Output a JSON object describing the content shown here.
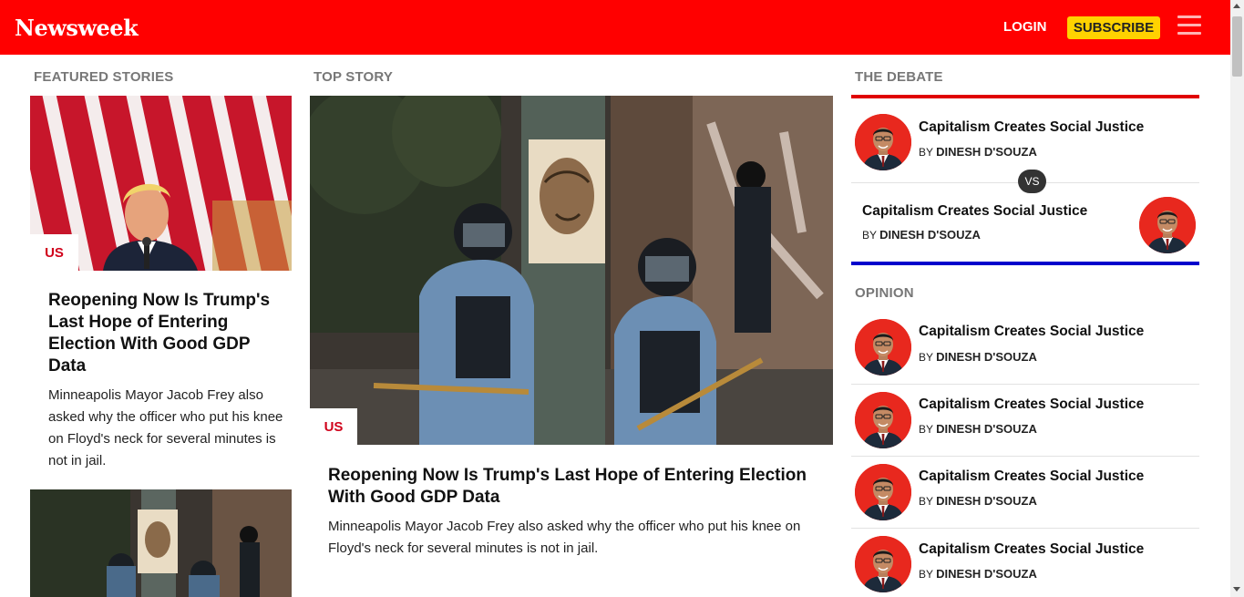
{
  "header": {
    "logo": "Newsweek",
    "login_label": "LOGIN",
    "subscribe_label": "SUBSCRIBE",
    "menu_icon": "hamburger-menu-icon",
    "brand_color": "#ff0000",
    "subscribe_color": "#ffd200"
  },
  "featured": {
    "label": "FEATURED STORIES",
    "items": [
      {
        "tag": "US",
        "headline": "Reopening Now Is Trump's Last Hope of Entering Election With Good GDP Data",
        "dek": "Minneapolis Mayor Jacob Frey also asked why the officer who put his knee on Floyd's neck for several minutes is not in jail."
      }
    ]
  },
  "top_story": {
    "label": "TOP STORY",
    "tag": "US",
    "headline": "Reopening Now Is Trump's Last Hope of Entering Election With Good GDP Data",
    "dek": "Minneapolis Mayor Jacob Frey also asked why the officer who put his knee on Floyd's neck for several minutes is not in jail."
  },
  "debate": {
    "label": "THE DEBATE",
    "vs_label": "VS",
    "top_color": "#e00000",
    "bottom_color": "#0000cc",
    "entries": [
      {
        "title": "Capitalism Creates Social Justice",
        "by": "BY",
        "author": "DINESH D'SOUZA"
      },
      {
        "title": "Capitalism Creates Social Justice",
        "by": "BY",
        "author": "DINESH D'SOUZA"
      }
    ]
  },
  "opinion": {
    "label": "OPINION",
    "items": [
      {
        "title": "Capitalism Creates Social Justice",
        "by": "BY",
        "author": "DINESH D'SOUZA"
      },
      {
        "title": "Capitalism Creates Social Justice",
        "by": "BY",
        "author": "DINESH D'SOUZA"
      },
      {
        "title": "Capitalism Creates Social Justice",
        "by": "BY",
        "author": "DINESH D'SOUZA"
      },
      {
        "title": "Capitalism Creates Social Justice",
        "by": "BY",
        "author": "DINESH D'SOUZA"
      }
    ]
  }
}
